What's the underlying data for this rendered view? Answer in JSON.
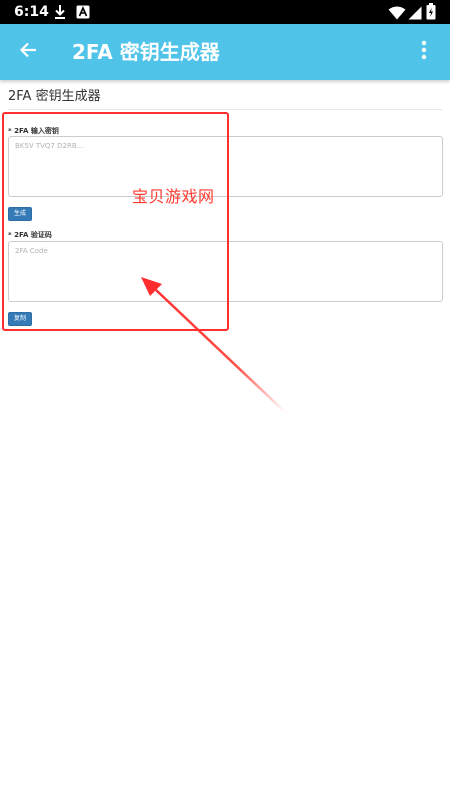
{
  "status_bar": {
    "time": "6:14",
    "left_icons": [
      "download-icon",
      "a-letter-icon"
    ],
    "right_icons": [
      "wifi-icon",
      "signal-icon",
      "battery-icon"
    ]
  },
  "app_bar": {
    "title": "2FA 密钥生成器",
    "back_icon": "back-arrow-icon",
    "menu_icon": "more-vertical-icon",
    "color": "#4fc3e8"
  },
  "page": {
    "heading": "2FA 密钥生成器"
  },
  "form": {
    "secret": {
      "required_mark": "*",
      "label": "2FA 输入密钥",
      "placeholder": "BK5V TVQ7 D2RB...",
      "value": ""
    },
    "generate_button": "生成",
    "code": {
      "required_mark": "*",
      "label": "2FA 验证码",
      "placeholder": "2FA Code",
      "value": ""
    },
    "copy_button": "复制",
    "button_color": "#337ab7"
  },
  "annotation": {
    "watermark": "宝贝游戏网",
    "color": "#ff2d2d"
  }
}
